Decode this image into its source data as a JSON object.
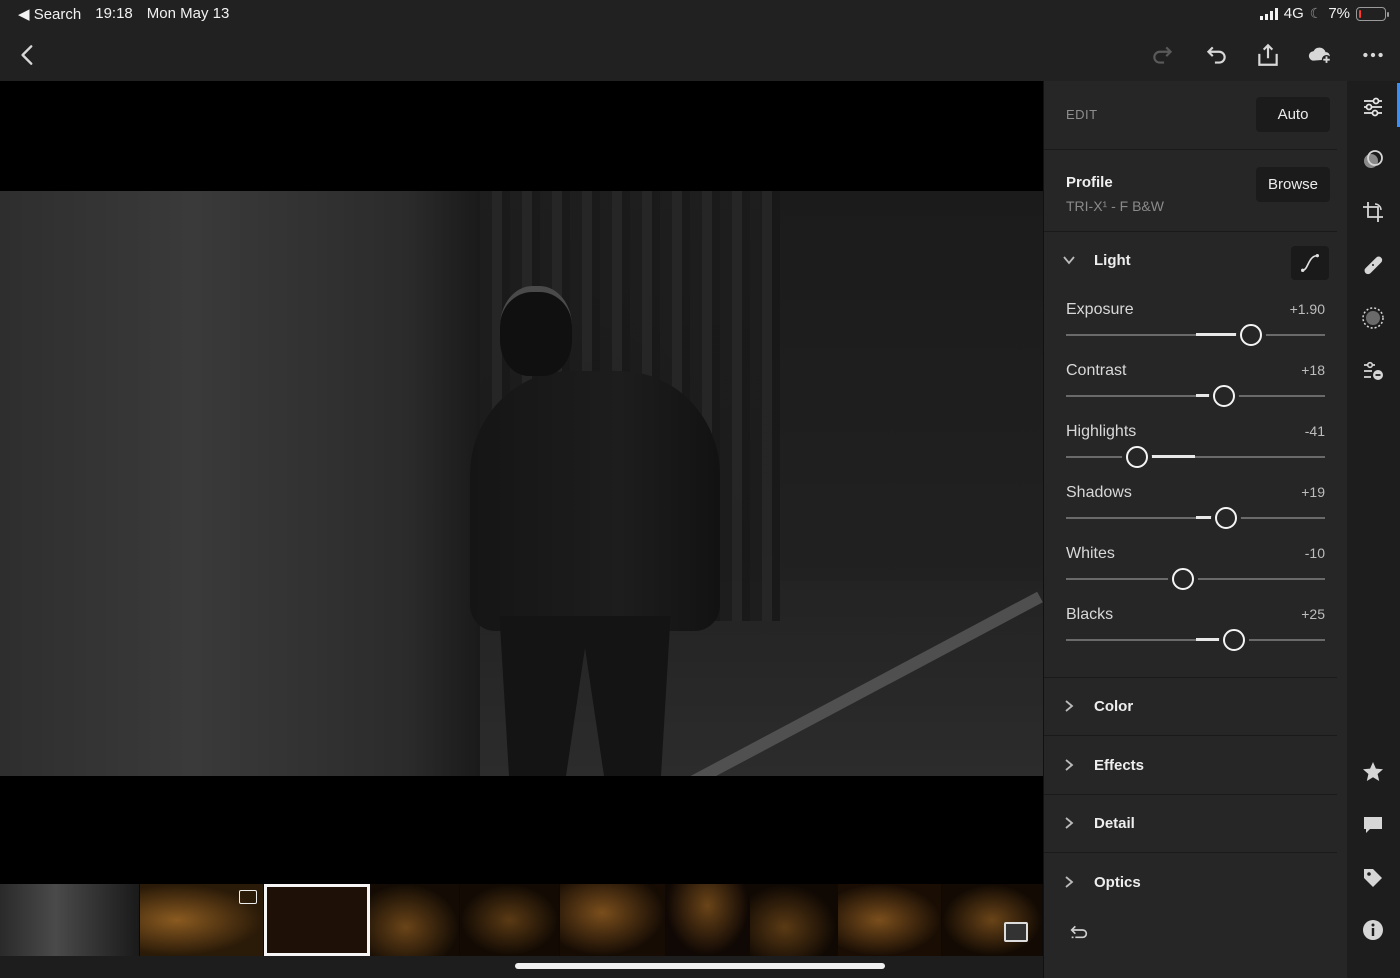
{
  "status_bar": {
    "back_app": "◀ Search",
    "time": "19:18",
    "date": "Mon May 13",
    "network": "4G",
    "battery": "7%",
    "battery_level": 0.07
  },
  "toolbar": {
    "icons": [
      "back-icon",
      "redo-icon",
      "undo-icon",
      "share-icon",
      "cloud-add-icon",
      "more-icon"
    ]
  },
  "panel": {
    "edit_label": "EDIT",
    "auto_label": "Auto",
    "profile_title": "Profile",
    "profile_value": "TRI-X¹ - F B&W",
    "browse_label": "Browse",
    "light_title": "Light",
    "sliders": [
      {
        "name": "Exposure",
        "value": "+1.90",
        "pos": 0.715
      },
      {
        "name": "Contrast",
        "value": "+18",
        "pos": 0.61
      },
      {
        "name": "Highlights",
        "value": "-41",
        "pos": 0.275
      },
      {
        "name": "Shadows",
        "value": "+19",
        "pos": 0.617
      },
      {
        "name": "Whites",
        "value": "-10",
        "pos": 0.45
      },
      {
        "name": "Blacks",
        "value": "+25",
        "pos": 0.647
      }
    ],
    "sections": [
      "Color",
      "Effects",
      "Detail",
      "Optics"
    ]
  },
  "rail": {
    "icons": [
      "sliders-icon",
      "selective-icon",
      "crop-icon",
      "healing-icon",
      "vignette-icon",
      "presets-icon",
      "star-icon",
      "comment-icon",
      "tag-icon",
      "info-icon"
    ]
  },
  "colors": {
    "accent": "#3d8ef0",
    "panel_bg": "#262626",
    "toolbar_bg": "#212121"
  }
}
